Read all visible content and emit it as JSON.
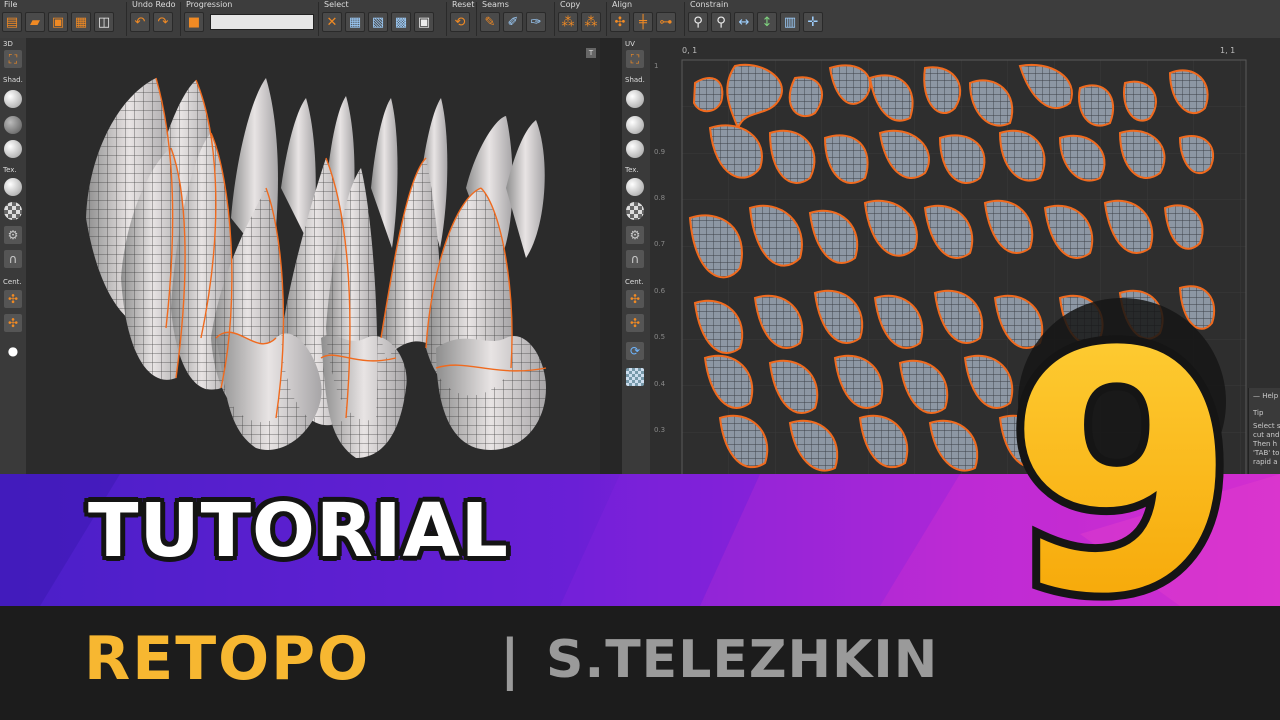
{
  "toolbar": {
    "groups": [
      {
        "label": "File",
        "icons": [
          "new-file-icon",
          "open-folder-icon",
          "save-icon",
          "save-as-icon",
          "screenshot-icon"
        ]
      },
      {
        "label": "Undo Redo",
        "icons": [
          "undo-icon",
          "redo-icon"
        ]
      },
      {
        "label": "Progression",
        "icons": [
          "stop-icon"
        ]
      },
      {
        "label": "Select",
        "icons": [
          "clear-selection-icon",
          "select-grid-icon",
          "select-edge-icon",
          "select-island-icon",
          "select-all-icon"
        ]
      },
      {
        "label": "Reset",
        "icons": [
          "reset-icon"
        ]
      },
      {
        "label": "Seams",
        "icons": [
          "seam-cut-icon",
          "seam-weld-icon",
          "seam-auto-icon"
        ]
      },
      {
        "label": "Copy",
        "icons": [
          "copy-icon",
          "paste-icon"
        ]
      },
      {
        "label": "Align",
        "icons": [
          "align-vertical-icon",
          "align-horizontal-icon",
          "align-center-icon"
        ]
      },
      {
        "label": "Constrain",
        "icons": [
          "pin-icon",
          "unpin-icon",
          "constrain-horizontal-icon",
          "constrain-vertical-icon",
          "constrain-both-icon",
          "constrain-free-icon"
        ]
      }
    ],
    "progression_value": 1.0
  },
  "panel_3d": {
    "labels": [
      "3D",
      "Shad.",
      "Tex.",
      "Cent."
    ],
    "tag": "T"
  },
  "panel_uv": {
    "labels": [
      "UV",
      "Shad.",
      "Tex.",
      "Cent."
    ],
    "corner_top_left": "0, 1",
    "corner_top_right": "1, 1",
    "axis_ticks": [
      "1",
      "0.9",
      "0.8",
      "0.7",
      "0.6",
      "0.5",
      "0.4",
      "0.3"
    ]
  },
  "help": {
    "title": "Help",
    "tip_label": "Tip",
    "lines": [
      "Select s",
      "cut and",
      "Then h",
      "'TAB' to",
      "rapid a"
    ]
  },
  "banner": {
    "title": "TUTORIAL",
    "subtitle": "RETOPO",
    "divider": "|",
    "author": "S.TELEZHKIN",
    "episode_number": "9"
  },
  "colors": {
    "accent_orange": "#f08a24",
    "banner_purple": "#6a1fd6",
    "banner_magenta": "#c526d8",
    "retopo_yellow": "#f7b731",
    "author_gray": "#9a9a9a",
    "badge_yellow": "#ffc21a"
  }
}
